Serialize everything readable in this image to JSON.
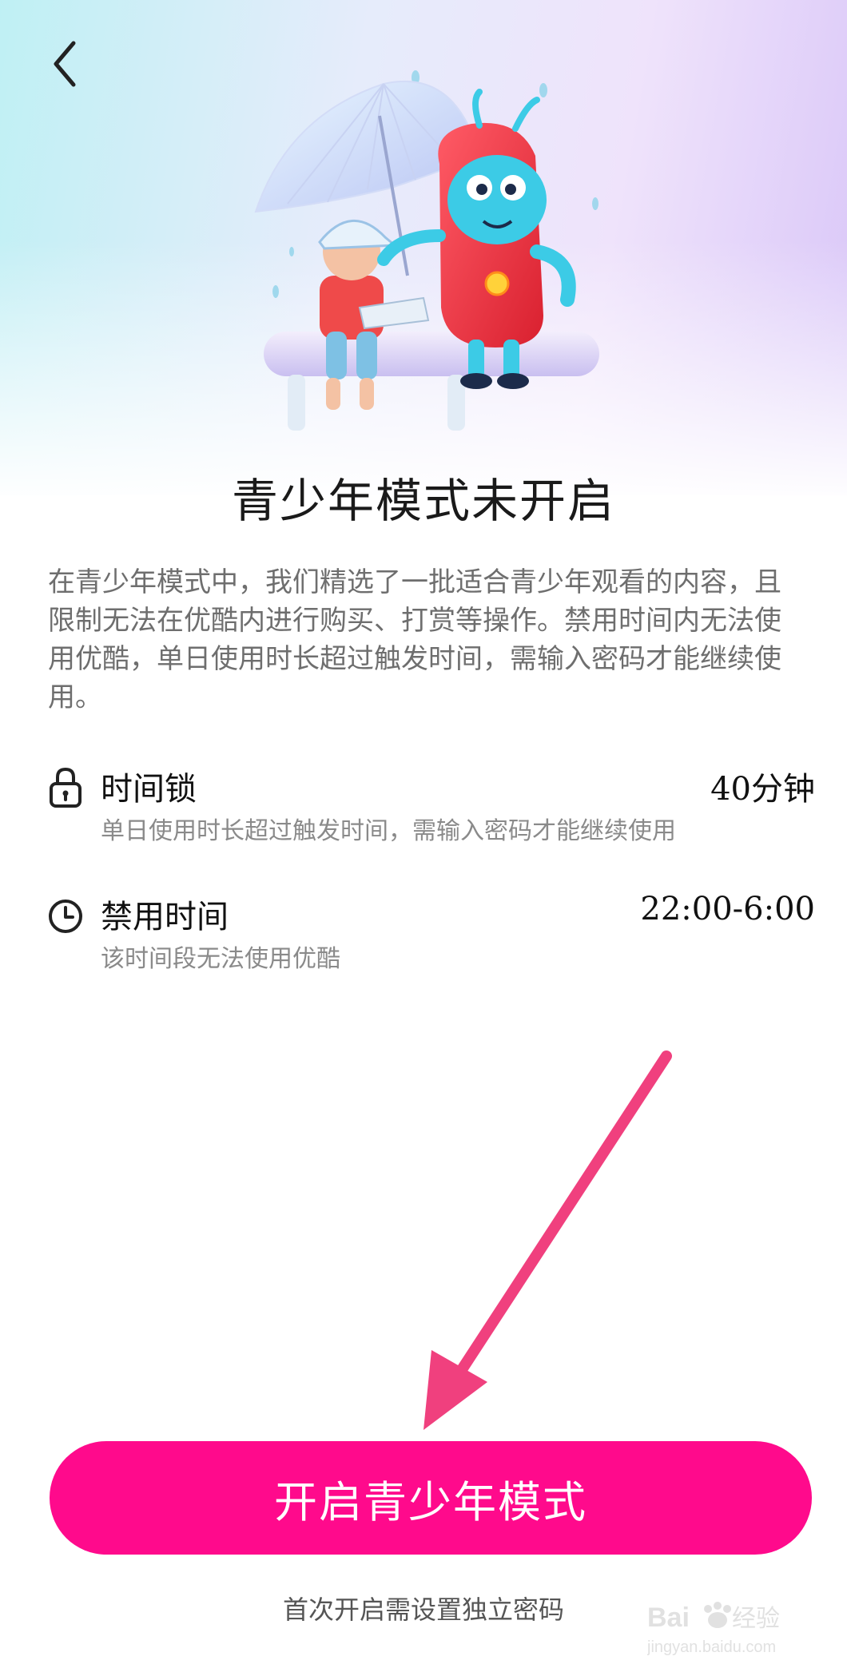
{
  "header": {
    "back_icon": "chevron-left-icon"
  },
  "hero": {
    "title": "青少年模式未开启",
    "description": "在青少年模式中，我们精选了一批适合青少年观看的内容，且限制无法在优酷内进行购买、打赏等操作。禁用时间内无法使用优酷，单日使用时长超过触发时间，需输入密码才能继续使用。"
  },
  "settings": [
    {
      "icon": "lock-icon",
      "label": "时间锁",
      "value": "40分钟",
      "desc": "单日使用时长超过触发时间，需输入密码才能继续使用"
    },
    {
      "icon": "clock-icon",
      "label": "禁用时间",
      "value": "22:00-6:00",
      "desc": "该时间段无法使用优酷"
    }
  ],
  "action": {
    "button_label": "开启青少年模式",
    "hint": "首次开启需设置独立密码"
  },
  "watermark": {
    "brand": "Baidu经验",
    "url": "jingyan.baidu.com"
  },
  "colors": {
    "accent": "#ff0a8c",
    "arrow": "#f0407e"
  }
}
